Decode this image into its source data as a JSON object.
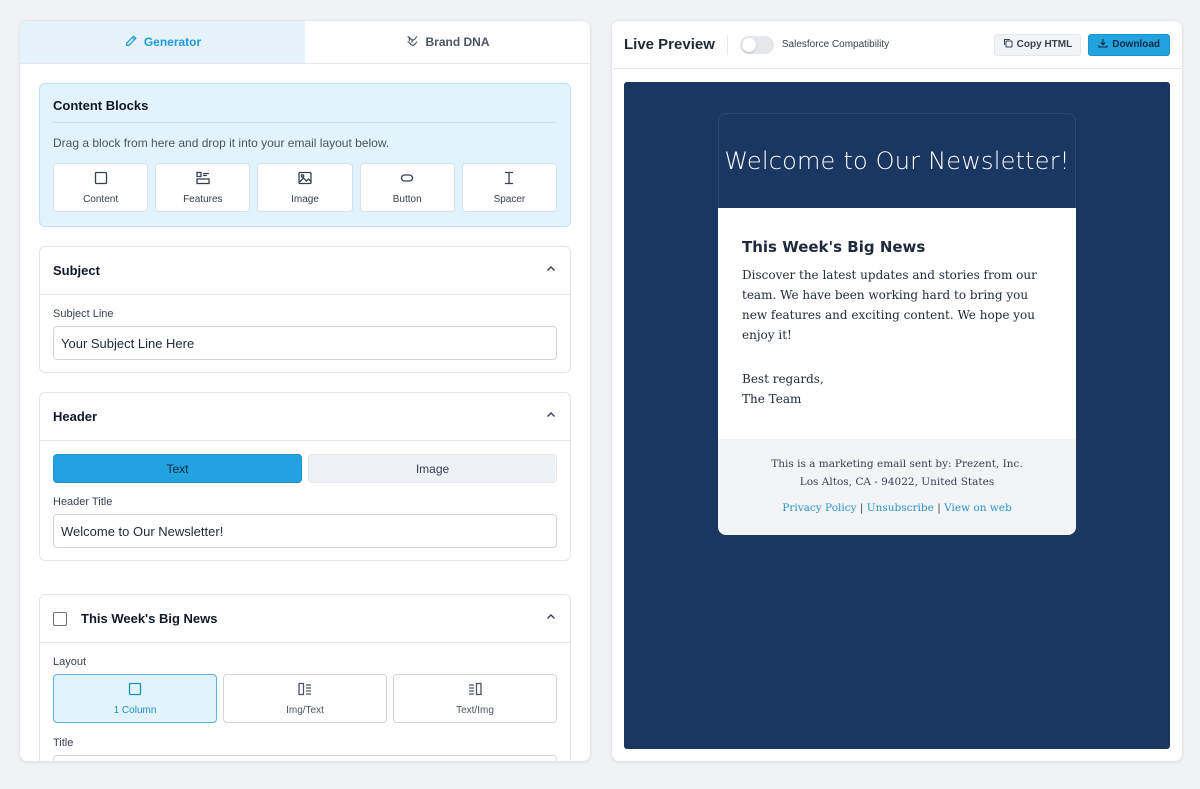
{
  "tabs": {
    "generator": "Generator",
    "brand_dna": "Brand DNA"
  },
  "content_blocks": {
    "title": "Content Blocks",
    "description": "Drag a block from here and drop it into your email layout below.",
    "items": [
      "Content",
      "Features",
      "Image",
      "Button",
      "Spacer"
    ]
  },
  "subject": {
    "title": "Subject",
    "label": "Subject Line",
    "value": "Your Subject Line Here"
  },
  "header": {
    "title": "Header",
    "mode_text": "Text",
    "mode_image": "Image",
    "field_label": "Header Title",
    "field_value": "Welcome to Our Newsletter!"
  },
  "news_section": {
    "title": "This Week's Big News",
    "layout_label": "Layout",
    "layouts": [
      "1 Column",
      "Img/Text",
      "Text/Img"
    ],
    "title_label": "Title"
  },
  "preview": {
    "title": "Live Preview",
    "toggle_label": "Salesforce Compatibility",
    "copy_label": "Copy HTML",
    "download_label": "Download"
  },
  "email": {
    "header_title": "Welcome to Our Newsletter!",
    "body_title": "This Week's Big News",
    "body_text": "Discover the latest updates and stories from our team. We have been working hard to bring you new features and exciting content. We hope you enjoy it!",
    "sign_line1": "Best regards,",
    "sign_line2": "The Team",
    "footer_line1": "This is a marketing email sent by: Prezent, Inc.",
    "footer_line2": "Los Altos, CA - 94022, United States",
    "link_privacy": "Privacy Policy",
    "link_unsubscribe": "Unsubscribe",
    "link_web": "View on web",
    "separator": "|"
  },
  "colors": {
    "accent": "#22a2df",
    "preview_bg": "#1a3761",
    "link": "#2a93c9"
  }
}
